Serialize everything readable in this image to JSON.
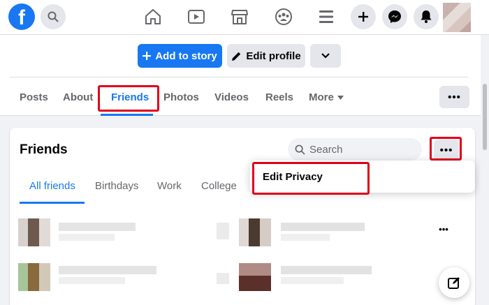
{
  "topbar": {
    "logo_letter": "f",
    "icons": [
      "home-icon",
      "watch-icon",
      "marketplace-icon",
      "groups-icon",
      "menu-icon",
      "plus-icon",
      "messenger-icon",
      "notifications-icon"
    ]
  },
  "profile_actions": {
    "add_story": "Add to story",
    "edit_profile": "Edit profile"
  },
  "profile_tabs": [
    "Posts",
    "About",
    "Friends",
    "Photos",
    "Videos",
    "Reels",
    "More"
  ],
  "friends_section": {
    "title": "Friends",
    "search_placeholder": "Search",
    "menu_dots": "•••",
    "subtabs": [
      "All friends",
      "Birthdays",
      "Work",
      "College"
    ],
    "dropdown": {
      "edit_privacy": "Edit Privacy"
    }
  },
  "colors": {
    "primary": "#1877f2",
    "highlight": "#e0001b",
    "background": "#f0f2f5"
  }
}
